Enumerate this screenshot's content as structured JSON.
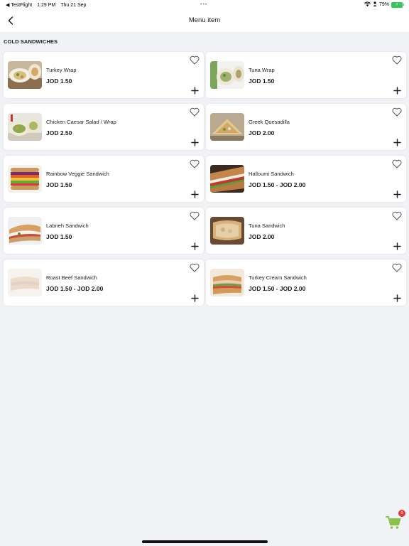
{
  "status_bar": {
    "back_app": "◀ TestFlight",
    "time": "1:29 PM",
    "date": "Thu 21 Sep",
    "dots": "•••",
    "battery_percent": "79%"
  },
  "nav": {
    "title": "Menu item"
  },
  "section": {
    "title": "COLD SANDWICHES"
  },
  "items": [
    {
      "name": "Turkey Wrap",
      "price": "JOD 1.50",
      "image": "wrap"
    },
    {
      "name": "Tuna Wrap",
      "price": "JOD 1.50",
      "image": "wrap-green"
    },
    {
      "name": "Chicken Caesar Salad / Wrap",
      "price": "JOD 2.50",
      "image": "caesar-wrap"
    },
    {
      "name": "Greek Quesadilla",
      "price": "JOD 2.00",
      "image": "quesadilla"
    },
    {
      "name": "Rainbow Veggie Sandwich",
      "price": "JOD 1.50",
      "image": "veggie-stack"
    },
    {
      "name": "Halloumi Sandwich",
      "price": "JOD 1.50 - JOD 2.00",
      "image": "halloumi"
    },
    {
      "name": "Labneh Sandwich",
      "price": "JOD 1.50",
      "image": "sub"
    },
    {
      "name": "Tuna Sandwich",
      "price": "JOD 2.00",
      "image": "toast"
    },
    {
      "name": "Roast Beef Sandwich",
      "price": "JOD 1.50 - JOD 2.00",
      "image": "faded-sub"
    },
    {
      "name": "Turkey Cream Sandwich",
      "price": "JOD 1.50 - JOD 2.00",
      "image": "turkey-sub"
    }
  ],
  "cart": {
    "count": "0",
    "color": "#8bc34a"
  },
  "colors": {
    "background": "#f1f2f6",
    "card": "#ffffff",
    "text": "#1c1c1e",
    "badge": "#e53935"
  }
}
